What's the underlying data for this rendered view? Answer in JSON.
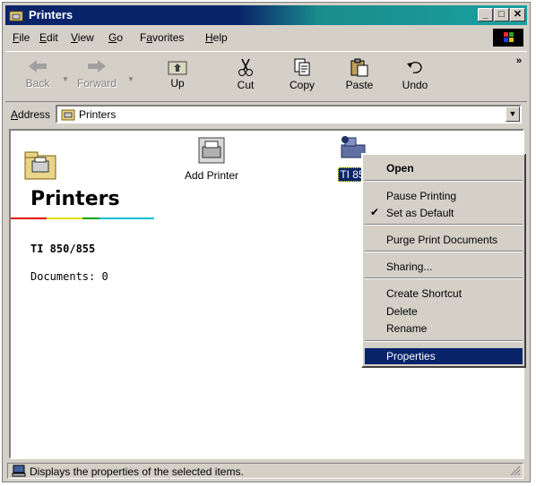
{
  "window": {
    "title": "Printers"
  },
  "menubar": {
    "items": [
      {
        "label": "File",
        "accel": "F",
        "rest": "ile"
      },
      {
        "label": "Edit",
        "accel": "E",
        "rest": "dit"
      },
      {
        "label": "View",
        "accel": "V",
        "rest": "iew"
      },
      {
        "label": "Go",
        "accel": "G",
        "rest": "o"
      },
      {
        "label": "Favorites",
        "accel": "a",
        "pre": "F",
        "rest": "vorites"
      },
      {
        "label": "Help",
        "accel": "H",
        "rest": "elp"
      }
    ]
  },
  "toolbar": {
    "back": "Back",
    "forward": "Forward",
    "up": "Up",
    "cut": "Cut",
    "copy": "Copy",
    "paste": "Paste",
    "undo": "Undo",
    "more": "»"
  },
  "address": {
    "label": "Address",
    "value": "Printers"
  },
  "left_pane": {
    "title": "Printers",
    "selected_name": "TI 850/855",
    "documents": "Documents: 0"
  },
  "items": [
    {
      "label": "Add Printer"
    },
    {
      "label": "TI 85"
    }
  ],
  "context_menu": {
    "items": [
      {
        "label": "Open",
        "bold": true
      },
      {
        "label": "Pause Printing"
      },
      {
        "label": "Set as Default",
        "checked": true
      },
      {
        "label": "Purge Print Documents"
      },
      {
        "label": "Sharing..."
      },
      {
        "label": "Create Shortcut"
      },
      {
        "label": "Delete"
      },
      {
        "label": "Rename"
      },
      {
        "label": "Properties",
        "highlighted": true
      }
    ]
  },
  "status": {
    "text": "Displays the properties of the selected items."
  },
  "colors": {
    "title_active": "#0a246a",
    "face": "#d4d0c8",
    "highlight": "#0a246a"
  }
}
